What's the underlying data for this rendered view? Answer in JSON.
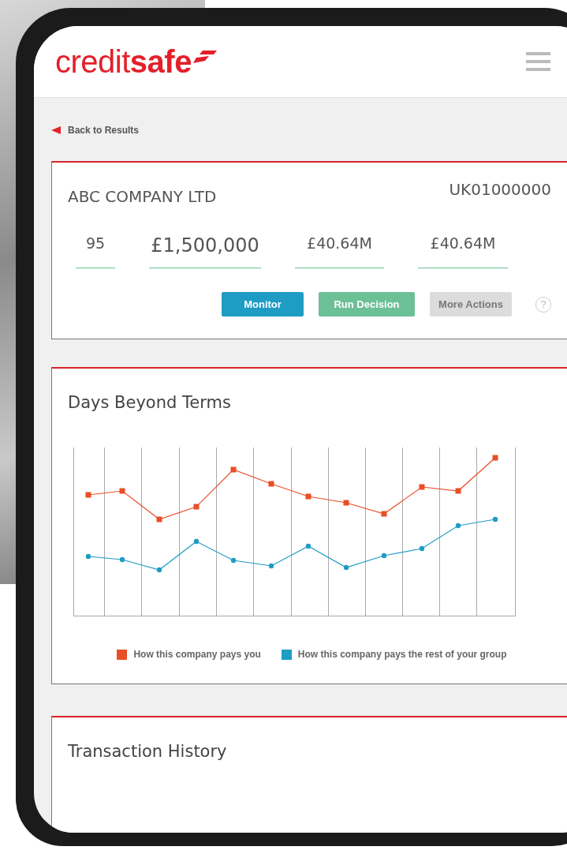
{
  "header": {
    "logo": "credit**safe**"
  },
  "back_link": {
    "label": "Back to Results"
  },
  "company_card": {
    "name": "ABC COMPANY LTD",
    "number": "UK01000000",
    "stats": [
      {
        "value": "95"
      },
      {
        "value": "£1,500,000"
      },
      {
        "value": "£40.64M"
      },
      {
        "value": "£40.64M"
      }
    ],
    "actions": [
      {
        "label": "Monitor",
        "kind": "primary"
      },
      {
        "label": "Run Decision",
        "kind": "success"
      },
      {
        "label": "More Actions",
        "kind": "muted"
      }
    ],
    "help": "?"
  },
  "dbt_card": {
    "title": "Days Beyond Terms",
    "legend": [
      {
        "label": "How this company pays you",
        "color": "#e84e27",
        "kind": "square"
      },
      {
        "label": "How this company pays the rest of your group",
        "color": "#1e9cc4",
        "kind": "circle"
      }
    ]
  },
  "transaction_card": {
    "title": "Transaction History"
  }
}
